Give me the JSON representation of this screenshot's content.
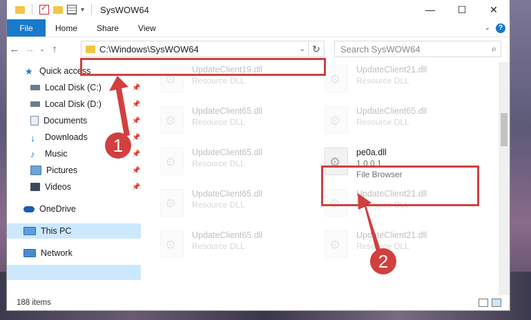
{
  "window": {
    "title": "SysWOW64",
    "controls": {
      "minimize": "—",
      "maximize": "☐",
      "close": "✕"
    }
  },
  "ribbon": {
    "tabs": [
      "File",
      "Home",
      "Share",
      "View"
    ],
    "help": "?"
  },
  "address": {
    "path": "C:\\Windows\\SysWOW64"
  },
  "search": {
    "placeholder": "Search SysWOW64"
  },
  "sidebar": {
    "items": [
      {
        "label": "Quick access",
        "icon": "star-icon",
        "pinned": false
      },
      {
        "label": "Local Disk (C:)",
        "icon": "drive-icon",
        "pinned": true
      },
      {
        "label": "Local Disk (D:)",
        "icon": "drive-icon",
        "pinned": true
      },
      {
        "label": "Documents",
        "icon": "documents-icon",
        "pinned": true
      },
      {
        "label": "Downloads",
        "icon": "download-icon",
        "pinned": true
      },
      {
        "label": "Music",
        "icon": "music-icon",
        "pinned": true
      },
      {
        "label": "Pictures",
        "icon": "pictures-icon",
        "pinned": true
      },
      {
        "label": "Videos",
        "icon": "videos-icon",
        "pinned": true
      },
      {
        "label": "OneDrive",
        "icon": "onedrive-icon",
        "pinned": false
      },
      {
        "label": "This PC",
        "icon": "pc-icon",
        "pinned": false
      },
      {
        "label": "Network",
        "icon": "network-icon",
        "pinned": false
      }
    ]
  },
  "files": [
    {
      "name": "UpdateClient19.dll",
      "sub": "Resource DLL"
    },
    {
      "name": "UpdateClient21.dll",
      "sub": "Resource DLL"
    },
    {
      "name": "UpdateClient65.dll",
      "sub": "Resource DLL"
    },
    {
      "name": "UpdateClient65.dll",
      "sub": "Resource DLL"
    },
    {
      "name": "UpdateClient65.dll",
      "sub": "Resource DLL"
    },
    {
      "name": "pe0a.dll",
      "version": "1.0.0.1",
      "sub": "File Browser"
    },
    {
      "name": "UpdateClient65.dll",
      "sub": "Resource DLL"
    },
    {
      "name": "UpdateClient21.dll",
      "sub": "Resource DLL"
    },
    {
      "name": "UpdateClient65.dll",
      "sub": "Resource DLL"
    },
    {
      "name": "UpdateClient21.dll",
      "sub": "Resource DLL"
    }
  ],
  "status": {
    "items": "188 items"
  },
  "annotations": {
    "badge1": "1",
    "badge2": "2",
    "color": "#d23f3f"
  }
}
